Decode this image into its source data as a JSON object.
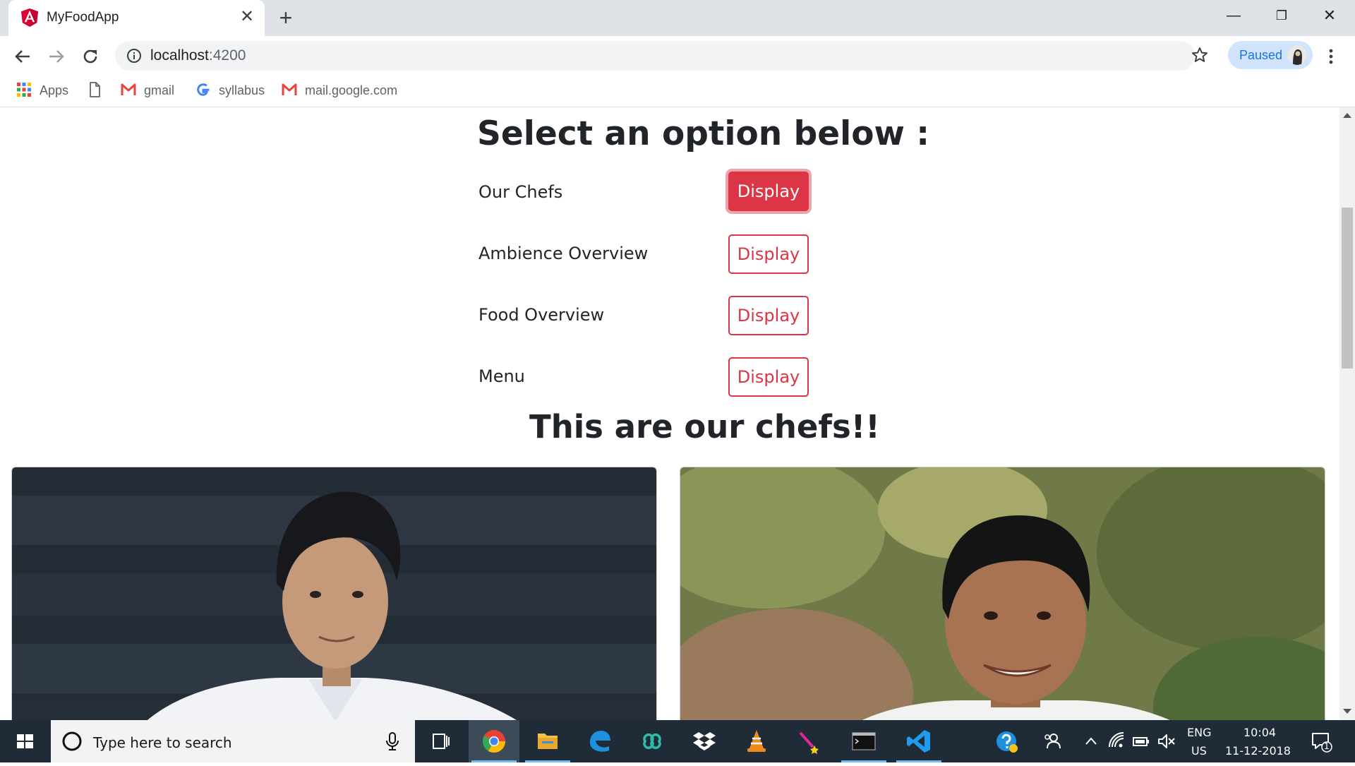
{
  "browser": {
    "tab_title": "MyFoodApp",
    "url_host": "localhost",
    "url_port": ":4200",
    "profile_status": "Paused"
  },
  "bookmarks": [
    {
      "label": "Apps",
      "icon": "apps-grid-icon"
    },
    {
      "label": "",
      "icon": "page-icon"
    },
    {
      "label": "gmail",
      "icon": "gmail-icon"
    },
    {
      "label": "syllabus",
      "icon": "google-icon"
    },
    {
      "label": "mail.google.com",
      "icon": "gmail-icon"
    }
  ],
  "page": {
    "heading": "Select an option below :",
    "options": [
      {
        "label": "Our Chefs",
        "button": "Display",
        "active": true
      },
      {
        "label": "Ambience Overview",
        "button": "Display",
        "active": false
      },
      {
        "label": "Food Overview",
        "button": "Display",
        "active": false
      },
      {
        "label": "Menu",
        "button": "Display",
        "active": false
      }
    ],
    "section_heading": "This are our chefs!!"
  },
  "taskbar": {
    "search_placeholder": "Type here to search",
    "language_top": "ENG",
    "language_bottom": "US",
    "time": "10:04",
    "date": "11-12-2018",
    "notification_count": "1"
  },
  "colors": {
    "accent_danger": "#dc3545",
    "taskbar_bg": "#1f2b36",
    "chrome_blue": "#1a73e8"
  }
}
